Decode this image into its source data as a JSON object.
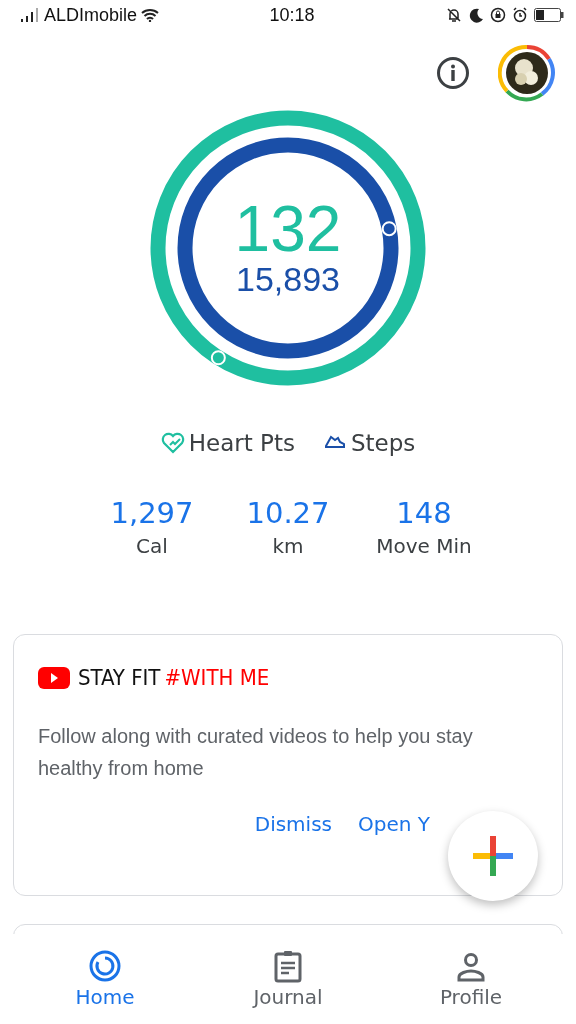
{
  "status_bar": {
    "carrier": "ALDImobile",
    "time": "10:18"
  },
  "rings": {
    "heart_points": "132",
    "steps": "15,893"
  },
  "legend": [
    {
      "kind": "heart",
      "label": "Heart Pts"
    },
    {
      "kind": "steps",
      "label": "Steps"
    }
  ],
  "stats": [
    {
      "value": "1,297",
      "label": "Cal"
    },
    {
      "value": "10.27",
      "label": "km"
    },
    {
      "value": "148",
      "label": "Move Min"
    }
  ],
  "promo_card": {
    "title_part_1": "STAY FIT",
    "title_part_2": "#WITH ME",
    "body": "Follow along with curated videos to help you stay healthy from home",
    "actions": [
      "Dismiss",
      "Open Y"
    ]
  },
  "nav": [
    {
      "kind": "home",
      "label": "Home",
      "selected": true
    },
    {
      "kind": "journal",
      "label": "Journal",
      "selected": false
    },
    {
      "kind": "profile",
      "label": "Profile",
      "selected": false
    }
  ]
}
